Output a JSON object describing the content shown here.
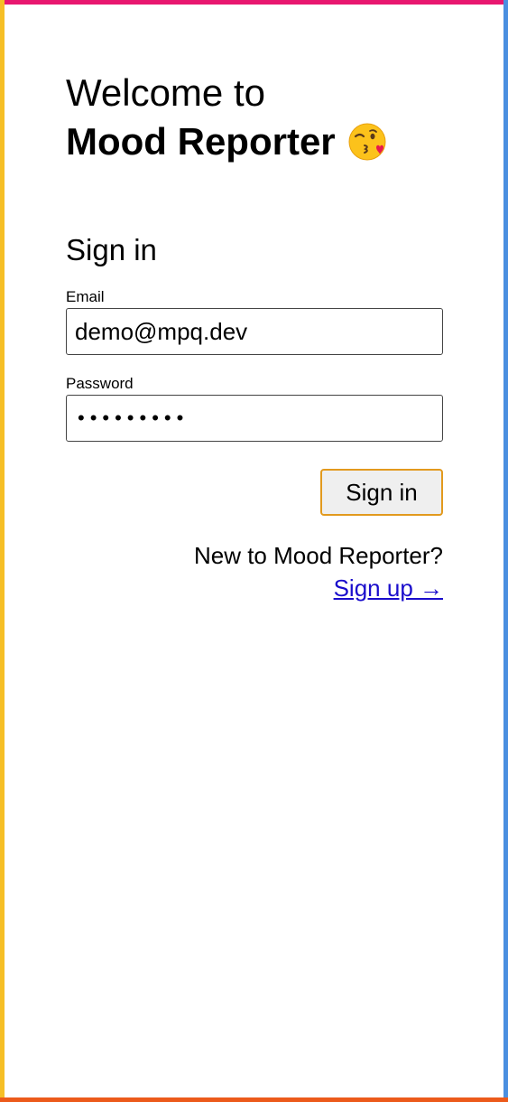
{
  "header": {
    "welcome_line": "Welcome to",
    "app_name": "Mood Reporter",
    "emoji_icon": "kissing-face-wink-heart-icon"
  },
  "form": {
    "title": "Sign in",
    "email_label": "Email",
    "email_value": "demo@mpq.dev",
    "password_label": "Password",
    "password_masked": "•••••••••",
    "submit_label": "Sign in"
  },
  "footer": {
    "new_user_text": "New to Mood Reporter?",
    "signup_link_label": "Sign up →"
  },
  "colors": {
    "border_top": "#e8176f",
    "border_left": "#f6bf26",
    "border_right": "#4a8fe0",
    "border_bottom": "#ec5a1b",
    "button_focus_ring": "#e29a1e",
    "link": "#1a0dcc"
  }
}
